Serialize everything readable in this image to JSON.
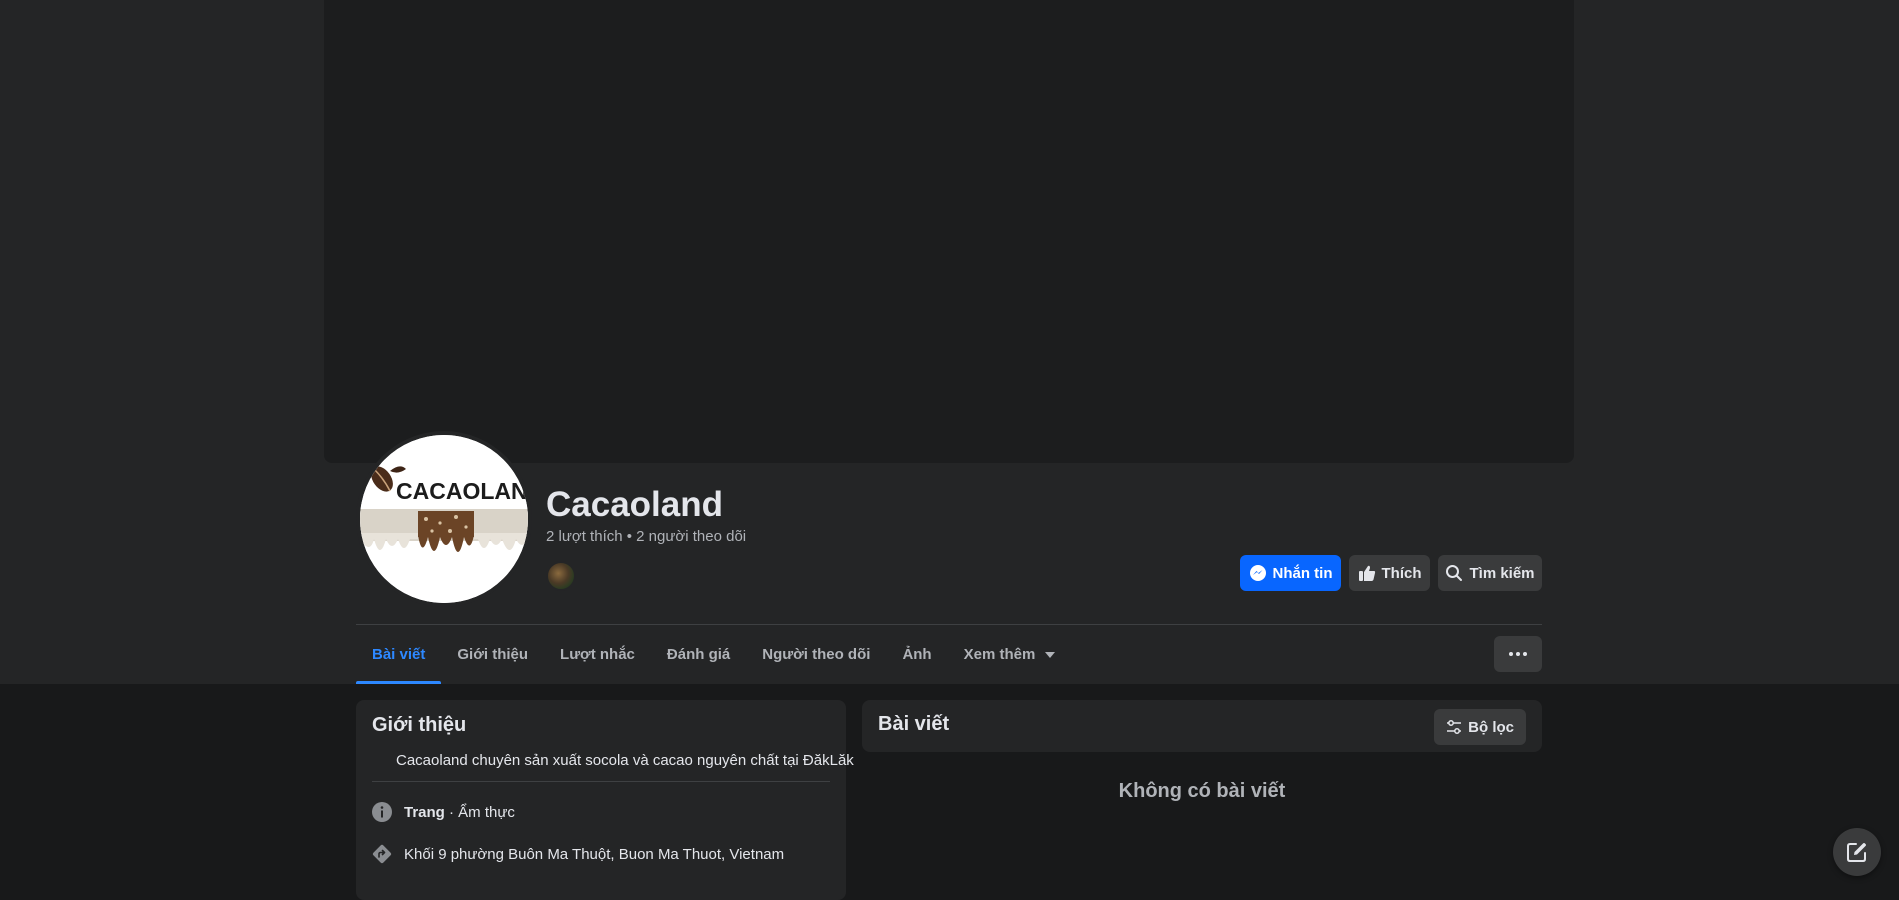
{
  "page": {
    "name": "Cacaoland",
    "stats": "2 lượt thích • 2 người theo dõi",
    "avatar_logo_text": "CACAOLAND"
  },
  "actions": {
    "message_label": "Nhắn tin",
    "like_label": "Thích",
    "search_label": "Tìm kiếm"
  },
  "tabs": [
    {
      "label": "Bài viết",
      "active": true
    },
    {
      "label": "Giới thiệu",
      "active": false
    },
    {
      "label": "Lượt nhắc",
      "active": false
    },
    {
      "label": "Đánh giá",
      "active": false
    },
    {
      "label": "Người theo dõi",
      "active": false
    },
    {
      "label": "Ảnh",
      "active": false
    },
    {
      "label": "Xem thêm",
      "active": false
    }
  ],
  "intro": {
    "title": "Giới thiệu",
    "bio": "Cacaoland chuyên sản xuất socola và cacao nguyên chất tại ĐăkLăk",
    "category_strong": "Trang",
    "category_rest": " · Ẩm thực",
    "address": "Khối 9 phường Buôn Ma Thuột, Buon Ma Thuot, Vietnam"
  },
  "posts": {
    "title": "Bài viết",
    "filter_label": "Bộ lọc",
    "empty_text": "Không có bài viết"
  },
  "colors": {
    "accent": "#0866ff",
    "active_tab": "#2d88ff",
    "background": "#18191a",
    "surface": "#242526"
  }
}
